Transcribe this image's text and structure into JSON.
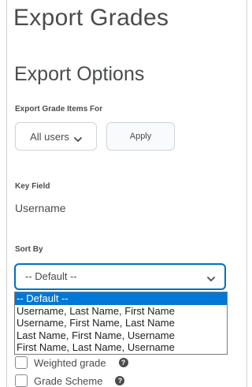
{
  "page": {
    "title": "Export Grades",
    "section_title": "Export Options"
  },
  "export_for": {
    "label": "Export Grade Items For",
    "selected": "All users",
    "apply_label": "Apply"
  },
  "key_field": {
    "label": "Key Field",
    "value": "Username"
  },
  "sort_by": {
    "label": "Sort By",
    "selected": "-- Default --",
    "options": [
      "-- Default --",
      "Username, Last Name, First Name",
      "Username, First Name, Last Name",
      "Last Name, First Name, Username",
      "First Name, Last Name, Username"
    ],
    "highlighted_index": 0
  },
  "options": {
    "weighted_grade": "Weighted grade",
    "grade_scheme": "Grade Scheme"
  },
  "colors": {
    "focus_border": "#006fbf",
    "highlight": "#0078d7",
    "text": "#494c4e"
  },
  "icons": {
    "dropdown": "chevron-down-icon",
    "help": "help-icon"
  }
}
